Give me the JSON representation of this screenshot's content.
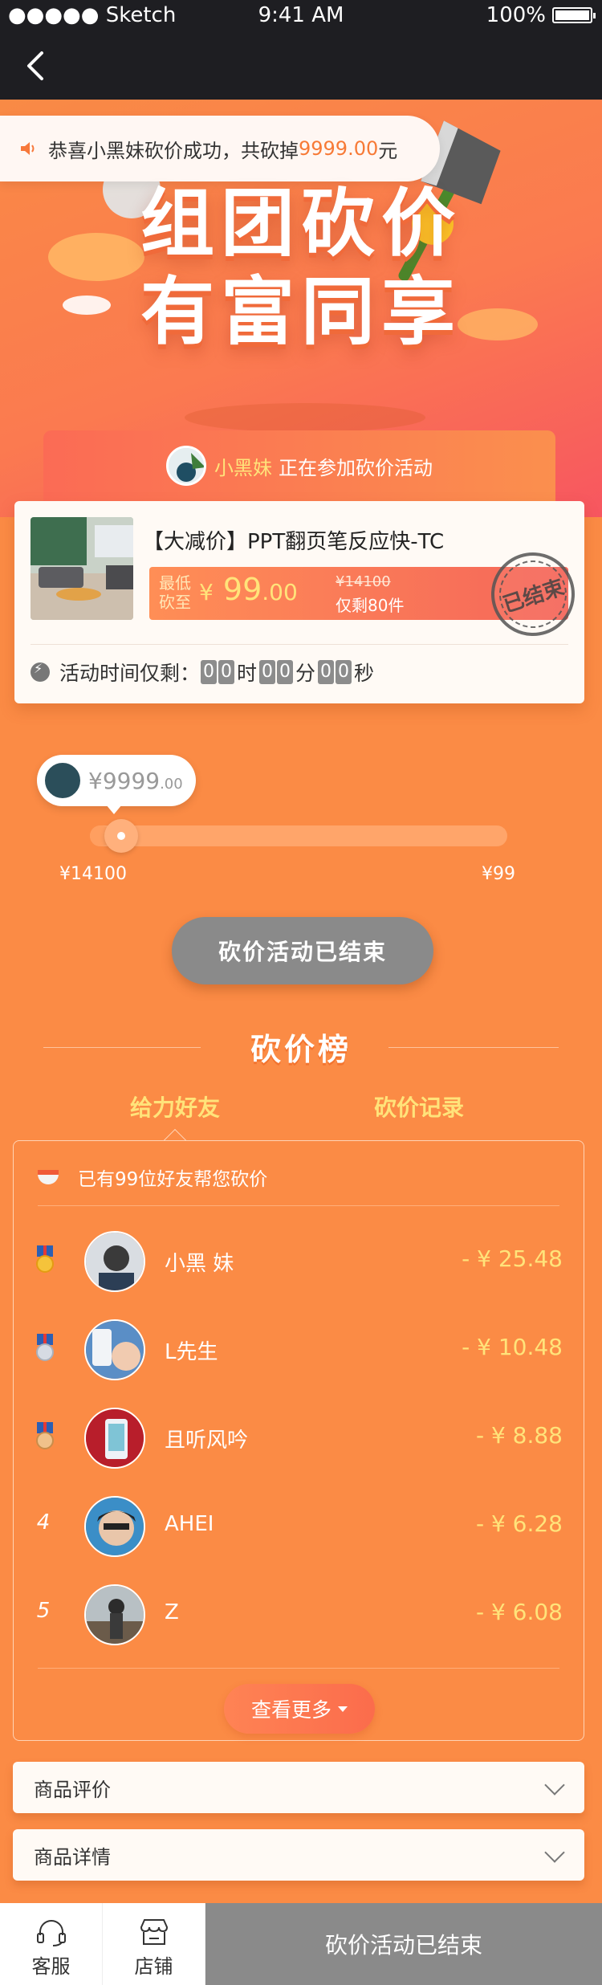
{
  "status_bar": {
    "carrier": "●●●●● Sketch",
    "time": "9:41 AM",
    "battery": "100%"
  },
  "notice": {
    "prefix": "恭喜小黑妹砍价成功，共砍掉",
    "amount": "9999.00",
    "suffix": "元"
  },
  "hero": {
    "title_line1": "组团砍价",
    "title_line2": "有富同享"
  },
  "participant": {
    "name": "小黑妹",
    "text": "正在参加砍价活动"
  },
  "product": {
    "title": "【大减价】PPT翻页笔反应快-TC",
    "price_label": "最低\n砍至",
    "currency": "¥",
    "price_int": "99",
    "price_dec": ".00",
    "original_price": "¥14100",
    "stock": "仅剩80件",
    "stamp": "已结束"
  },
  "timer": {
    "label": "活动时间仅剩：",
    "hours": [
      "0",
      "0"
    ],
    "h_unit": "时",
    "minutes": [
      "0",
      "0"
    ],
    "m_unit": "分",
    "seconds": [
      "0",
      "0"
    ],
    "s_unit": "秒"
  },
  "progress": {
    "current": "¥9999",
    "current_dec": ".00",
    "min_label": "¥14100",
    "max_label": "¥99",
    "fraction": 0.05
  },
  "ended_button": "砍价活动已结束",
  "ranking": {
    "title": "砍价榜",
    "tabs": [
      "给力好友",
      "砍价记录"
    ],
    "helpers_text": "已有99位好友帮您砍价",
    "rows": [
      {
        "rank": "1",
        "name": "小黑 妹",
        "amount": "- ¥ 25.48"
      },
      {
        "rank": "2",
        "name": "L先生",
        "amount": "- ¥ 10.48"
      },
      {
        "rank": "3",
        "name": "且听风吟",
        "amount": "- ¥ 8.88"
      },
      {
        "rank": "4",
        "name": "AHEI",
        "amount": "- ¥ 6.28"
      },
      {
        "rank": "5",
        "name": "Z",
        "amount": "- ¥ 6.08"
      }
    ],
    "more": "查看更多"
  },
  "accordions": [
    "商品评价",
    "商品详情"
  ],
  "tabbar": {
    "service": "客服",
    "shop": "店铺",
    "action": "砍价活动已结束"
  },
  "colors": {
    "brand": "#fb8b45",
    "accent": "#ffe37a",
    "disabled": "#8a8a8a"
  }
}
